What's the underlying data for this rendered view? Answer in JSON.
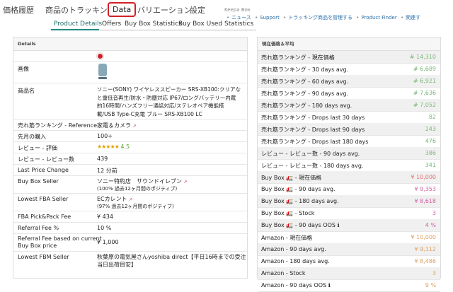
{
  "main_tabs": [
    "価格履歴",
    "商品のトラッキング",
    "Data",
    "バリエーション",
    "設定"
  ],
  "top_links": {
    "brand": "Keepa Box",
    "items": [
      "ニュース",
      "Support",
      "トラッキング商品を管理する",
      "Product Finder",
      "関連す"
    ]
  },
  "sub_tabs": [
    "Product Details",
    "Offers",
    "Buy Box Statistics",
    "Buy Box Used Statistics"
  ],
  "details": {
    "title": "Details",
    "image_label": "画像",
    "product_name_label": "商品名",
    "product_name_lines": [
      "ソニー(SONY) ワイヤレススピーカー SRS-XB100:クリアな",
      "と重低音再生/防水・防塵対応 IP67/ロングバッテリー内蔵",
      "約16時間/ハンズフリー通話対応/ステレオペア機能搭",
      "載/USB Type-C充電 ブルー SRS-XB100 LC"
    ],
    "rows": [
      {
        "label": "売れ筋ランキング - Reference",
        "value": "家電＆カメラ"
      },
      {
        "label": "先月の購入",
        "value": "100+"
      },
      {
        "label": "レビュー - 評価",
        "value": "4.5",
        "stars": "★★★★★"
      },
      {
        "label": "レビュー - レビュー数",
        "value": "439"
      },
      {
        "label": "Last Price Change",
        "value": "12 分前"
      },
      {
        "label": "Buy Box Seller",
        "value": "ソニー特約店　サウンドイレブン",
        "sub": "(100% 過去12ヶ月間のポジティブ)"
      },
      {
        "label": "Lowest FBA Seller",
        "value": "ECカレント",
        "sub": "(97% 過去12ヶ月間のポジティブ)"
      },
      {
        "label": "FBA Pick&Pack Fee",
        "value": "¥ 434"
      },
      {
        "label": "Referral Fee %",
        "value": "10 %"
      },
      {
        "label": "Referral Fee based on current",
        "label2": "Buy Box price",
        "value": "¥ 1,000"
      },
      {
        "label": "Lowest FBM Seller",
        "value": "秋葉原の電気屋さんyoshiba direct【平日16時までの受注",
        "value2": "当日出荷目安】"
      }
    ]
  },
  "stats": {
    "title": "現在価格＆平均",
    "rows": [
      {
        "label": "売れ筋ランキング - 現在価格",
        "value": "# 14,310",
        "color": "green"
      },
      {
        "label": "売れ筋ランキング - 30 days avg.",
        "value": "# 6,689",
        "color": "green"
      },
      {
        "label": "売れ筋ランキング - 60 days avg.",
        "value": "# 6,921",
        "color": "green"
      },
      {
        "label": "売れ筋ランキング - 90 days avg.",
        "value": "# 7,636",
        "color": "green"
      },
      {
        "label": "売れ筋ランキング - 180 days avg.",
        "value": "# 7,052",
        "color": "green"
      },
      {
        "label": "売れ筋ランキング - Drops last 30 days",
        "value": "82",
        "color": "green"
      },
      {
        "label": "売れ筋ランキング - Drops last 90 days",
        "value": "243",
        "color": "green"
      },
      {
        "label": "売れ筋ランキング - Drops last 180 days",
        "value": "476",
        "color": "green"
      },
      {
        "label": "レビュー - レビュー数 - 90 days avg.",
        "value": "386",
        "color": "green"
      },
      {
        "label": "レビュー - レビュー数 - 180 days avg.",
        "value": "341",
        "color": "green"
      },
      {
        "label": "Buy Box 🚛 - 現在価格",
        "value": "¥ 10,000",
        "color": "red"
      },
      {
        "label": "Buy Box 🚛 - 90 days avg.",
        "value": "¥ 9,353",
        "color": "pink"
      },
      {
        "label": "Buy Box 🚛 - 180 days avg.",
        "value": "¥ 8,618",
        "color": "pink"
      },
      {
        "label": "Buy Box 🚛 - Stock",
        "value": "3",
        "color": "pink"
      },
      {
        "label": "Buy Box 🚛 - 90 days OOS ℹ",
        "value": "4 %",
        "color": "pink"
      },
      {
        "label": "Amazon - 現在価格",
        "value": "¥ 10,000",
        "color": "orange"
      },
      {
        "label": "Amazon - 90 days avg.",
        "value": "¥ 9,112",
        "color": "orange"
      },
      {
        "label": "Amazon - 180 days avg.",
        "value": "¥ 8,486",
        "color": "orange"
      },
      {
        "label": "Amazon - Stock",
        "value": "3",
        "color": "orange"
      },
      {
        "label": "Amazon - 90 days OOS ℹ",
        "value": "9 %",
        "color": "orange"
      }
    ]
  },
  "colors": {
    "accent": "#1f8a84",
    "active_tab_border": "#d0202a",
    "link_pink": "#c2185b"
  }
}
